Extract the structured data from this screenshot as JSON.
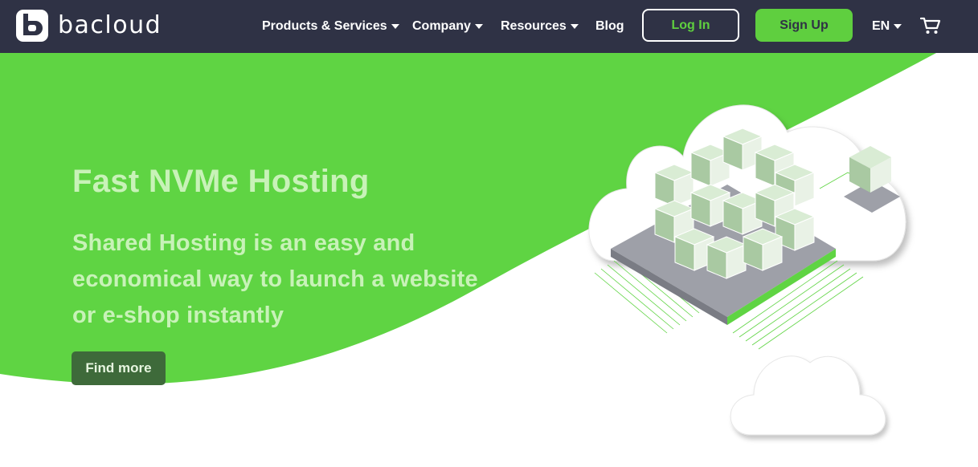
{
  "header": {
    "logo_text": "bacloud",
    "nav": [
      {
        "label": "Products & Services",
        "has_dropdown": true
      },
      {
        "label": "Company",
        "has_dropdown": true
      },
      {
        "label": "Resources",
        "has_dropdown": true
      },
      {
        "label": "Blog",
        "has_dropdown": false
      }
    ],
    "login_label": "Log In",
    "signup_label": "Sign Up",
    "language": "EN",
    "cart_icon": "cart-icon"
  },
  "hero": {
    "title": "Fast NVMe Hosting",
    "subtitle": "Shared Hosting is an easy and economical way to launch a website or e-shop instantly",
    "button_label": "Find more"
  },
  "colors": {
    "nav_bg": "#2f3245",
    "accent_green": "#5fcf3f",
    "hero_text": "#c8f2b8",
    "button_dark_green": "#3e6a3a"
  }
}
